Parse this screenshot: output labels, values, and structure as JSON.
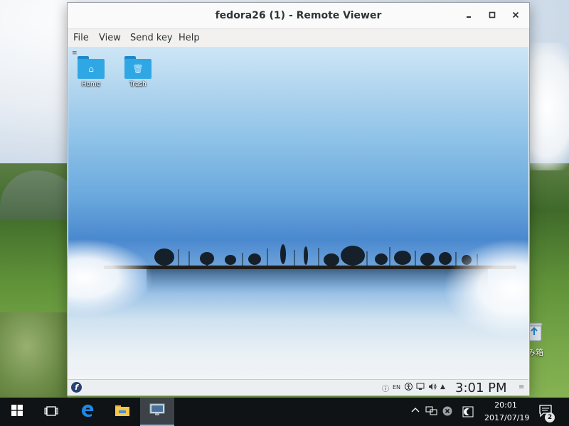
{
  "window": {
    "title": "fedora26 (1) - Remote Viewer",
    "controls": {
      "minimize": "minimize-icon",
      "maximize": "maximize-icon",
      "close": "close-icon"
    }
  },
  "menubar": {
    "items": [
      {
        "label": "File"
      },
      {
        "label": "View"
      },
      {
        "label": "Send key"
      },
      {
        "label": "Help"
      }
    ]
  },
  "guest": {
    "desktop_icons": [
      {
        "label": "Home",
        "icon": "home-folder-icon"
      },
      {
        "label": "Trash",
        "icon": "trash-folder-icon"
      }
    ],
    "panel": {
      "logo": "f",
      "tray": {
        "info": "ⓘ",
        "lang": "EN",
        "accessibility": "accessibility-icon",
        "network": "network-icon",
        "volume": "volume-icon",
        "arrow": "arrow-up-icon"
      },
      "clock": "3:01 PM"
    }
  },
  "host": {
    "recycle_bin_label": "み箱",
    "taskbar": {
      "clock_time": "20:01",
      "clock_date": "2017/07/19",
      "notification_count": "2"
    }
  },
  "colors": {
    "taskbar": "#101315",
    "fedora_blue": "#294172",
    "folder_blue": "#2fa7e4"
  }
}
